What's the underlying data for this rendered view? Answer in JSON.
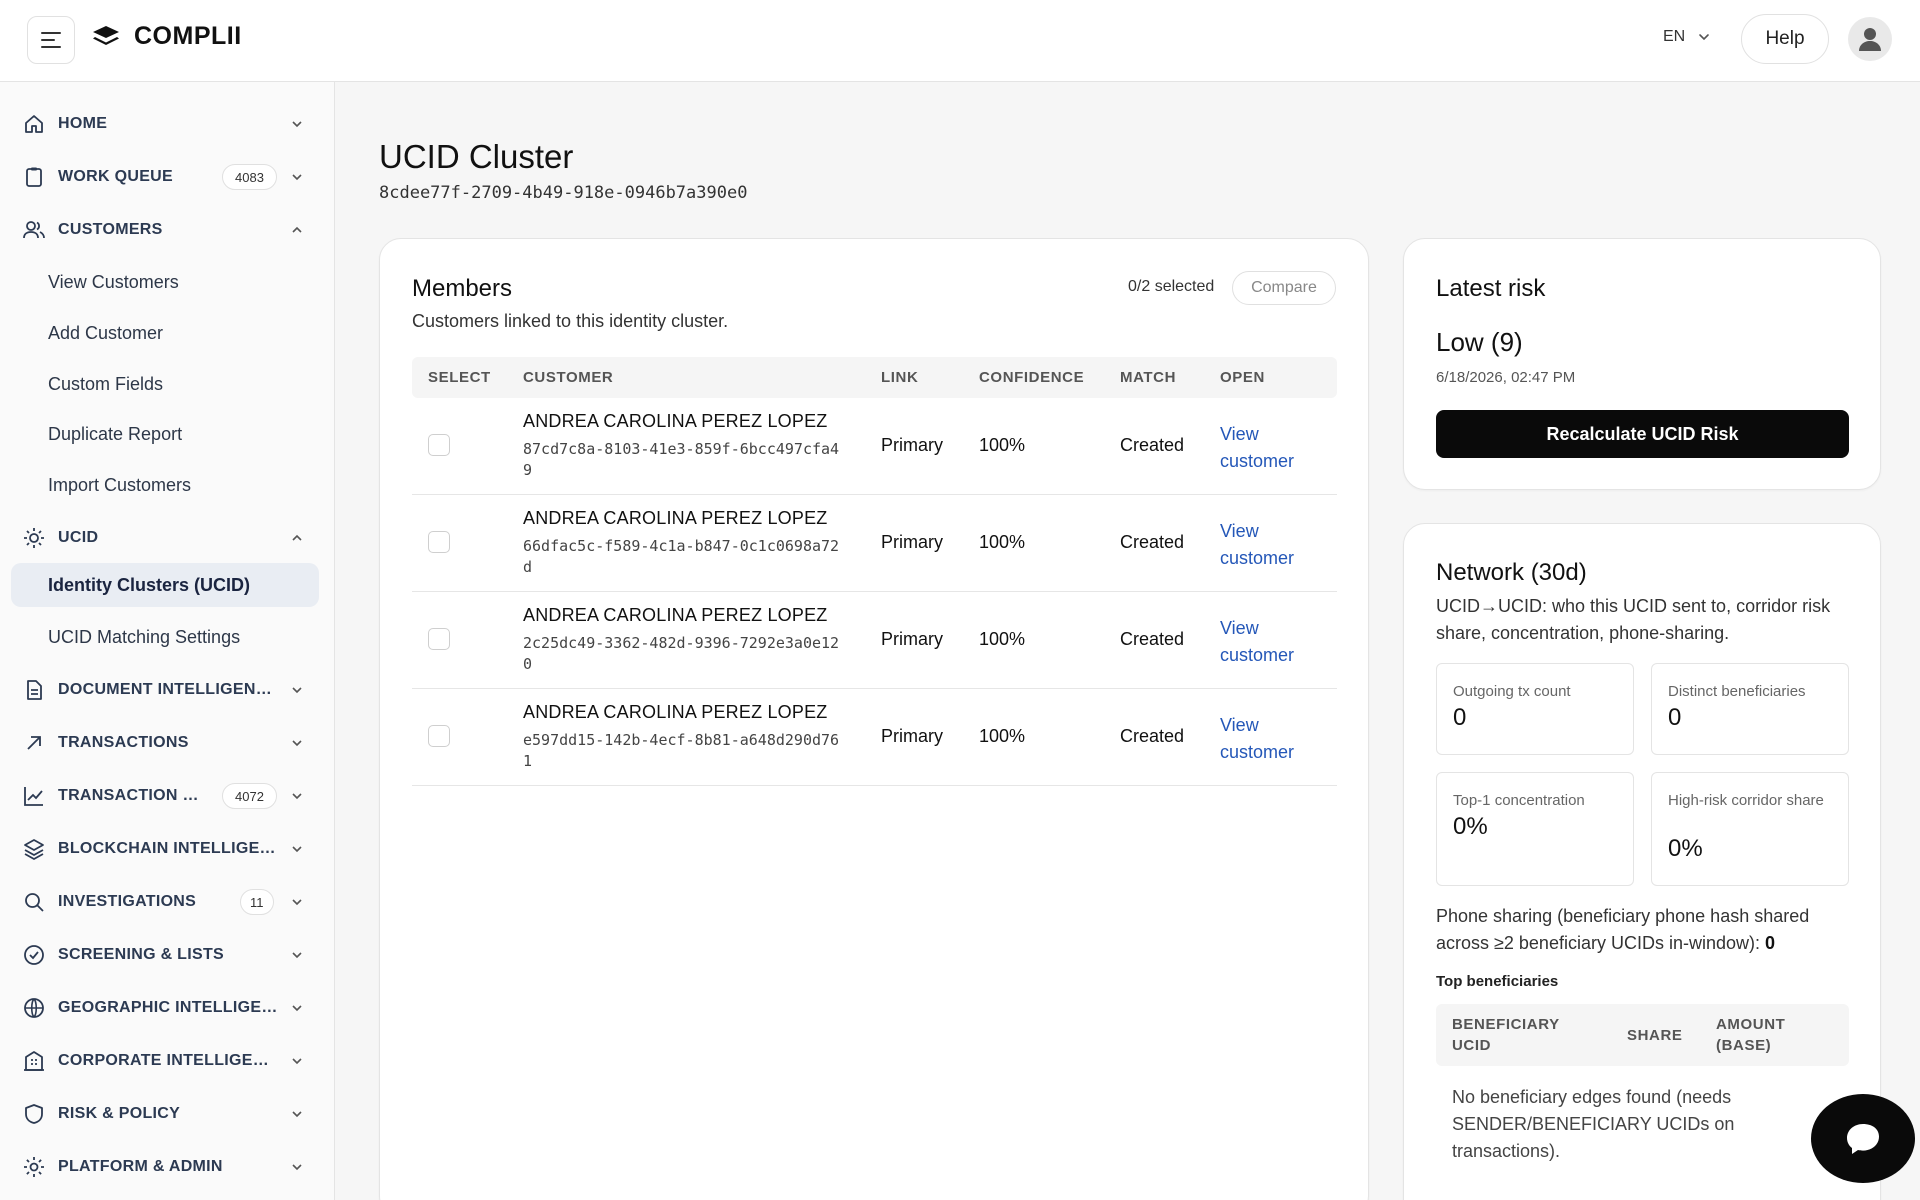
{
  "app": {
    "brand": "COMPLII"
  },
  "header": {
    "language": "EN",
    "help_label": "Help"
  },
  "sidebar": {
    "home": "HOME",
    "work_queue": "WORK QUEUE",
    "work_queue_badge": "4083",
    "customers": "CUSTOMERS",
    "customers_sub": [
      "View Customers",
      "Add Customer",
      "Custom Fields",
      "Duplicate Report",
      "Import Customers"
    ],
    "ucid": "UCID",
    "ucid_sub": [
      "Identity Clusters (UCID)",
      "UCID Matching Settings"
    ],
    "document_intelligence": "DOCUMENT INTELLIGENCE",
    "transactions": "TRANSACTIONS",
    "transaction_monitoring": "TRANSACTION M…",
    "transaction_monitoring_badge": "4072",
    "blockchain": "BLOCKCHAIN INTELLIGEN…",
    "investigations": "INVESTIGATIONS",
    "investigations_badge": "11",
    "screening": "SCREENING & LISTS",
    "geographic": "GEOGRAPHIC INTELLIGE…",
    "corporate": "CORPORATE INTELLIGEN…",
    "risk_policy": "RISK & POLICY",
    "platform_admin": "PLATFORM & ADMIN"
  },
  "page": {
    "title": "UCID Cluster",
    "cluster_id": "8cdee77f-2709-4b49-918e-0946b7a390e0"
  },
  "members": {
    "title": "Members",
    "subtitle": "Customers linked to this identity cluster.",
    "selected": "0/2 selected",
    "compare_label": "Compare",
    "columns": [
      "SELECT",
      "CUSTOMER",
      "LINK",
      "CONFIDENCE",
      "MATCH",
      "OPEN"
    ],
    "rows": [
      {
        "name": "ANDREA CAROLINA PEREZ LOPEZ",
        "id": "87cd7c8a-8103-41e3-859f-6bcc497cfa49",
        "link": "Primary",
        "confidence": "100%",
        "match": "Created",
        "open": "View customer"
      },
      {
        "name": "ANDREA CAROLINA PEREZ LOPEZ",
        "id": "66dfac5c-f589-4c1a-b847-0c1c0698a72d",
        "link": "Primary",
        "confidence": "100%",
        "match": "Created",
        "open": "View customer"
      },
      {
        "name": "ANDREA CAROLINA PEREZ LOPEZ",
        "id": "2c25dc49-3362-482d-9396-7292e3a0e120",
        "link": "Primary",
        "confidence": "100%",
        "match": "Created",
        "open": "View customer"
      },
      {
        "name": "ANDREA CAROLINA PEREZ LOPEZ",
        "id": "e597dd15-142b-4ecf-8b81-a648d290d761",
        "link": "Primary",
        "confidence": "100%",
        "match": "Created",
        "open": "View customer"
      }
    ]
  },
  "risk": {
    "title": "Latest risk",
    "value": "Low (9)",
    "date": "6/18/2026, 02:47 PM",
    "recalc_label": "Recalculate UCID Risk"
  },
  "network": {
    "title": "Network (30d)",
    "description": "UCID→UCID: who this UCID sent to, corridor risk share, concentration, phone-sharing.",
    "stats": [
      {
        "label": "Outgoing tx count",
        "value": "0"
      },
      {
        "label": "Distinct beneficiaries",
        "value": "0"
      },
      {
        "label": "Top-1 concentration",
        "value": "0%"
      },
      {
        "label": "High-risk corridor share",
        "value": "0%"
      }
    ],
    "phone_sharing_text": "Phone sharing (beneficiary phone hash shared across ≥2 beneficiary UCIDs in-window):",
    "phone_sharing_value": "0",
    "top_beneficiaries_title": "Top beneficiaries",
    "ben_columns": [
      "BENEFICIARY UCID",
      "SHARE",
      "AMOUNT (BASE)"
    ],
    "empty_text": "No beneficiary edges found (needs SENDER/BENEFICIARY UCIDs on transactions)."
  }
}
